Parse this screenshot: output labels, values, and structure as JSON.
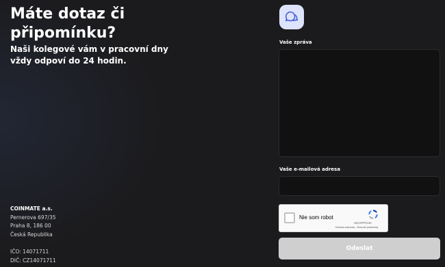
{
  "contact": {
    "heading": "Máte dotaz či připomínku?",
    "subheading": "Naši kolegové vám v pracovní dny vždy odpoví do 24 hodin."
  },
  "company": {
    "name": "COINMATE a.s.",
    "street": "Pernerova 697/35",
    "city": "Praha 8, 186 00",
    "country": "Česká Republika",
    "ico": "IČO: 14071711",
    "dic": "DIČ: CZ14071711"
  },
  "form": {
    "badge_icon": "chat-bubbles-icon",
    "message_label": "Vaše zpráva",
    "message_value": "",
    "email_label": "Vaše e-mailová adresa",
    "email_value": "",
    "submit_label": "Odeslat",
    "accent_color": "#dde3fb"
  },
  "recaptcha": {
    "label": "Nie som robot",
    "brand": "reCAPTCHA",
    "terms": "Ochrana súkromia - Zmluvné podmienky",
    "logo_icon": "recaptcha-logo-icon"
  }
}
